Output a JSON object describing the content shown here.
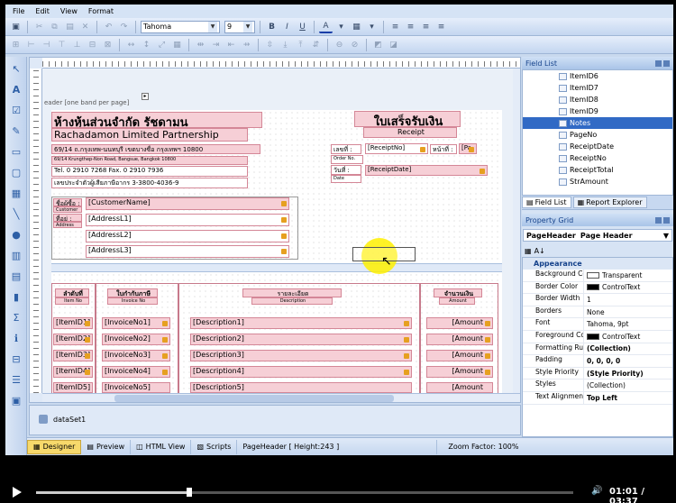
{
  "menu": [
    "File",
    "Edit",
    "View",
    "Format"
  ],
  "toolbar": {
    "font": "Tahoma",
    "size": "9",
    "bold": "B",
    "italic": "I",
    "underline": "U",
    "forecolor": "A"
  },
  "designer": {
    "band_label": "eader [one band per page]",
    "company_th": "ห้างหุ้นส่วนจำกัด รัชดามน",
    "company_en": "Rachadamon Limited Partnership",
    "addr_th": "69/14 ถ.กรุงเทพ-นนทบุรี เขตบางซื่อ กรุงเทพฯ 10800",
    "addr_en": "69/14 Krungthep-Non Road, Bangsue, Bangkok 10800",
    "tel": "Tel. 0 2910 7268 Fax. 0 2910 7936",
    "taxid": "เลขประจำตัวผู้เสียภาษีอากร 3-3800-4036-9",
    "receipt_th": "ใบเสร็จรับเงิน",
    "receipt_en": "Receipt",
    "no_th": "เลขที่ :",
    "receipt_no": "[ReceiptNo]",
    "page_th": "หน้าที่ :",
    "page_val": "[Pa",
    "order_no": "Order No.",
    "date_th": "วันที่ :",
    "date_en": "Date",
    "receipt_date": "[ReceiptDate]",
    "name_th": "ชื่อผู้ซื้อ :",
    "customer_en": "Customer",
    "address_th": "ที่อยู่ :",
    "address_en": "Address",
    "customer_name": "[CustomerName]",
    "address1": "[AddressL1]",
    "address2": "[AddressL2]",
    "address3": "[AddressL3]",
    "col_itemno_th": "ลำดับที่",
    "col_itemno_en": "Item No",
    "col_invoice_th": "ใบกำกับภาษี",
    "col_invoice_en": "Invoice No",
    "col_desc_th": "รายละเอียด",
    "col_desc_en": "Description",
    "col_amount_th": "จำนวนเงิน",
    "col_amount_en": "Amount",
    "rows": [
      {
        "item": "[ItemID1]",
        "inv": "[InvoiceNo1]",
        "desc": "[Description1]",
        "amt": "[Amount"
      },
      {
        "item": "[ItemID2]",
        "inv": "[InvoiceNo2]",
        "desc": "[Description2]",
        "amt": "[Amount"
      },
      {
        "item": "[ItemID3]",
        "inv": "[InvoiceNo3]",
        "desc": "[Description3]",
        "amt": "[Amount"
      },
      {
        "item": "[ItemID4]",
        "inv": "[InvoiceNo4]",
        "desc": "[Description4]",
        "amt": "[Amount"
      },
      {
        "item": "[ItemID5]",
        "inv": "[InvoiceNo5]",
        "desc": "[Description5]",
        "amt": "[Amount"
      }
    ]
  },
  "dataset": "dataSet1",
  "status": {
    "designer": "Designer",
    "preview": "Preview",
    "html": "HTML View",
    "scripts": "Scripts",
    "band": "PageHeader [ Height:243 ]",
    "zoom": "Zoom Factor: 100%"
  },
  "fieldlist": {
    "title": "Field List",
    "items": [
      "ItemID6",
      "ItemID7",
      "ItemID8",
      "ItemID9",
      "Notes",
      "PageNo",
      "ReceiptDate",
      "ReceiptNo",
      "ReceiptTotal",
      "StrAmount"
    ],
    "tab_fields": "Field List",
    "tab_explorer": "Report Explorer"
  },
  "propgrid": {
    "title": "Property Grid",
    "object_name": "PageHeader",
    "object_type": "Page Header",
    "category": "Appearance",
    "props": [
      {
        "name": "Background Co",
        "value": "Transparent",
        "swatch": "#ffffff",
        "bold": false
      },
      {
        "name": "Border Color",
        "value": "ControlText",
        "swatch": "#000000",
        "bold": false
      },
      {
        "name": "Border Width",
        "value": "1",
        "swatch": "",
        "bold": false
      },
      {
        "name": "Borders",
        "value": "None",
        "swatch": "",
        "bold": false
      },
      {
        "name": "Font",
        "value": "Tahoma, 9pt",
        "swatch": "",
        "bold": false
      },
      {
        "name": "Foreground Col",
        "value": "ControlText",
        "swatch": "#000000",
        "bold": false
      },
      {
        "name": "Formatting Rul",
        "value": "(Collection)",
        "swatch": "",
        "bold": true
      },
      {
        "name": "Padding",
        "value": "0, 0, 0, 0",
        "swatch": "",
        "bold": true
      },
      {
        "name": "Style Priority",
        "value": "(Style Priority)",
        "swatch": "",
        "bold": true
      },
      {
        "name": "Styles",
        "value": "(Collection)",
        "swatch": "",
        "bold": false
      },
      {
        "name": "Text Alignment",
        "value": "Top Left",
        "swatch": "",
        "bold": true
      }
    ]
  },
  "player": {
    "time": "01:01 / 03:37",
    "progress": 0.285
  }
}
